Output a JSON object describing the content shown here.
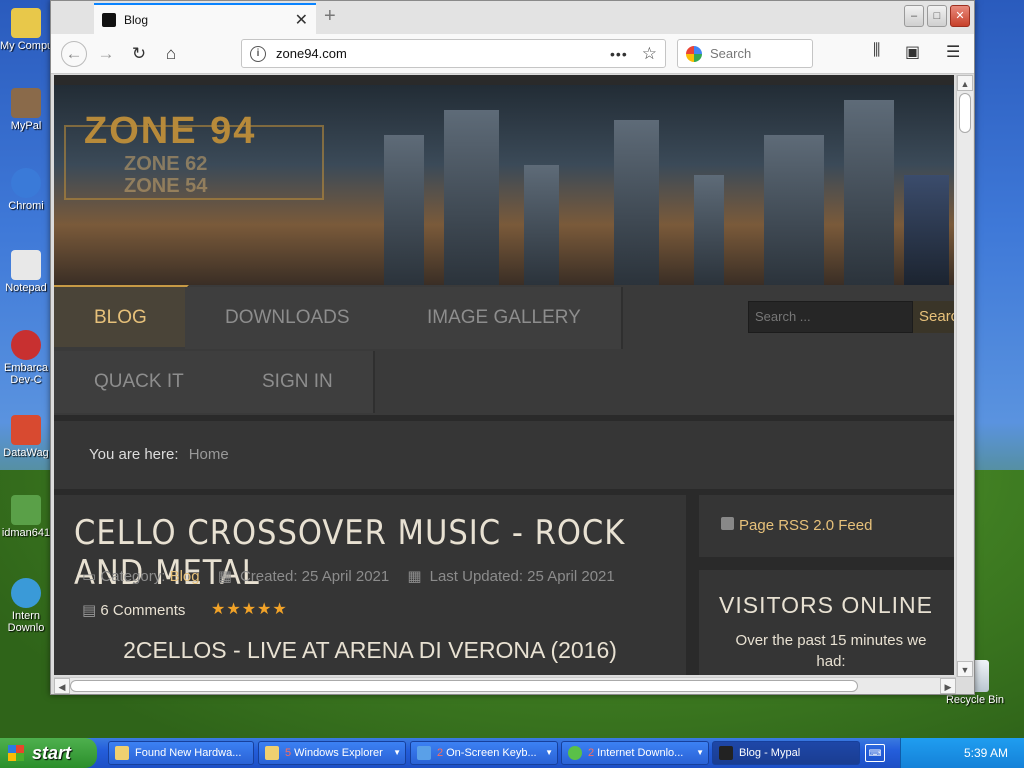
{
  "desktop": {
    "icons": [
      {
        "label": "My Compu",
        "color": "#e8c84a"
      },
      {
        "label": "MyPal",
        "color": "#8a6a4a"
      },
      {
        "label": "Chromi",
        "color": "#3a7ad8"
      },
      {
        "label": "Notepad",
        "color": "#e8e8e8"
      },
      {
        "label": "Embarca Dev-C",
        "color": "#c83030"
      },
      {
        "label": "DataWag",
        "color": "#d84a30"
      },
      {
        "label": "idman641",
        "color": "#5aa048"
      },
      {
        "label": "Intern Downlo",
        "color": "#3a9ad8"
      }
    ],
    "recycle_bin": "Recycle Bin"
  },
  "browser": {
    "tab_title": "Blog",
    "url": "zone94.com",
    "search_placeholder": "Search",
    "window_buttons": {
      "minimize": "‒",
      "maximize": "□",
      "close": "✕"
    }
  },
  "site": {
    "logo": "ZONE 94",
    "logo_sub": [
      "ZONE 62",
      "ZONE 54"
    ],
    "menu": [
      "BLOG",
      "DOWNLOADS",
      "IMAGE GALLERY",
      "QUACK IT",
      "SIGN IN"
    ],
    "search_placeholder": "Search ...",
    "search_button": "Search",
    "breadcrumb_label": "You are here:",
    "breadcrumb_home": "Home",
    "article": {
      "title": "CELLO CROSSOVER MUSIC - ROCK AND METAL",
      "category_label": "Category:",
      "category": "Blog",
      "created": "Created: 25 April 2021",
      "updated": "Last Updated: 25 April 2021",
      "comments": "6 Comments",
      "rating_stars": 5,
      "subtitle": "2CELLOS - LIVE AT ARENA DI VERONA (2016)"
    },
    "sidebar": {
      "rss": "Page RSS 2.0 Feed",
      "visitors_heading": "VISITORS ONLINE",
      "visitors_text": "Over the past 15 minutes we had:"
    }
  },
  "taskbar": {
    "start": "start",
    "tasks": [
      {
        "label": "Found New Hardwa...",
        "num": ""
      },
      {
        "label": "Windows Explorer",
        "num": "5"
      },
      {
        "label": "On-Screen Keyb...",
        "num": "2"
      },
      {
        "label": "Internet Downlo...",
        "num": "2"
      },
      {
        "label": "Blog - Mypal",
        "num": ""
      }
    ],
    "clock": "5:39 AM"
  }
}
